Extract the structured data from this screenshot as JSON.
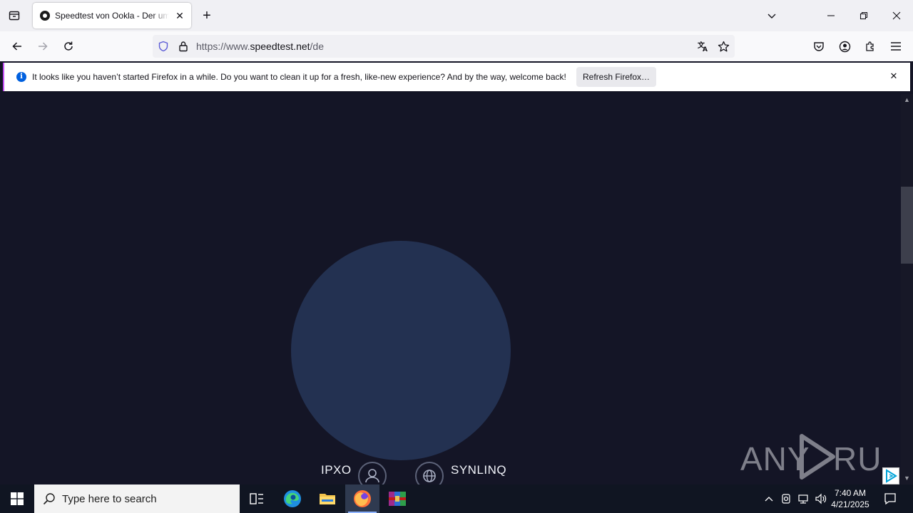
{
  "browser": {
    "tab": {
      "title": "Speedtest von Ookla - Der umfassende Geschwindigkeitstest"
    },
    "new_tab_label": "+",
    "url": {
      "scheme_host_prefix": "https://www.",
      "domain": "speedtest.net",
      "path": "/de"
    }
  },
  "notification": {
    "message": "It looks like you haven’t started Firefox in a while. Do you want to clean it up for a fresh, like-new experience? And by the way, welcome back!",
    "button_label": "Refresh Firefox…"
  },
  "page": {
    "isp_name": "IPXO",
    "server_name": "SYNLINQ",
    "watermark": "ANY RUN"
  },
  "taskbar": {
    "search_placeholder": "Type here to search",
    "time": "7:40 AM",
    "date": "4/21/2025"
  },
  "colors": {
    "page_bg": "#141526",
    "gauge": "#233151",
    "notification_accent": "#c04ef0",
    "info_blue": "#0060df"
  }
}
